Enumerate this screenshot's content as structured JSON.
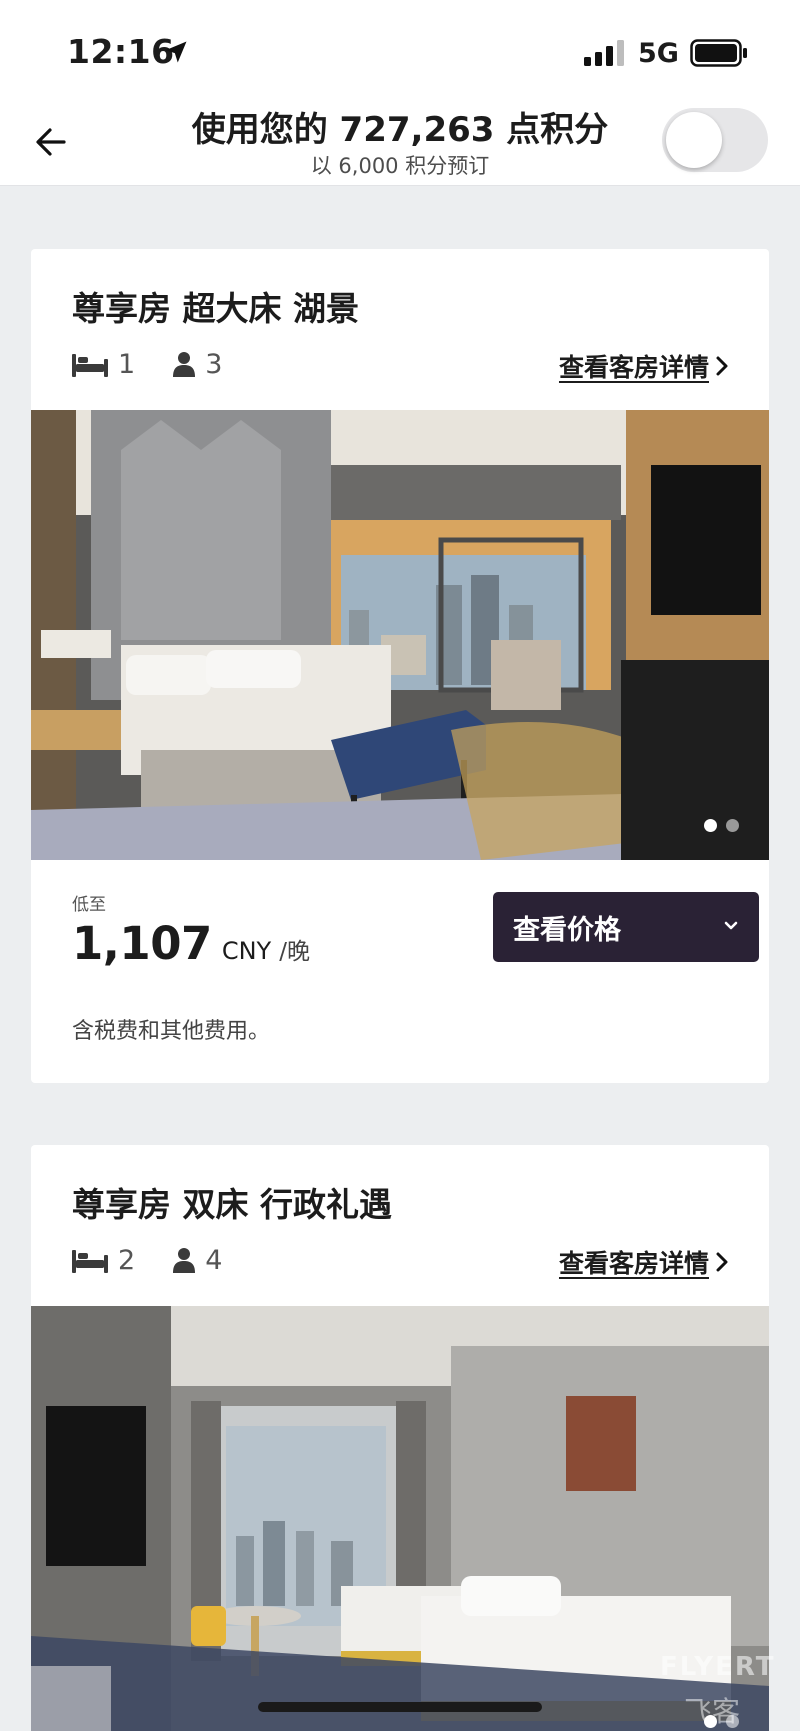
{
  "status_bar": {
    "time": "12:16",
    "network": "5G"
  },
  "header": {
    "title": "使用您的 727,263 点积分",
    "subtitle": "以 6,000 积分预订",
    "toggle_on": false
  },
  "rooms": [
    {
      "title": "尊享房 超大床 湖景",
      "beds": "1",
      "guests": "3",
      "details_link": "查看客房详情",
      "photo_dots": 2,
      "active_dot": 1,
      "price_from_label": "低至",
      "price": "1,107",
      "currency": "CNY",
      "per_night": "/晚",
      "view_price_button": "查看价格",
      "tax_note": "含税费和其他费用。"
    },
    {
      "title": "尊享房 双床 行政礼遇",
      "beds": "2",
      "guests": "4",
      "details_link": "查看客房详情",
      "photo_dots": 2,
      "active_dot": 1
    }
  ],
  "watermark": {
    "text": "FLYERT",
    "sub": "飞客"
  },
  "colors": {
    "page_bg": "#eceef0",
    "button_dark": "#2a2235",
    "text_primary": "#1c1c1c"
  }
}
